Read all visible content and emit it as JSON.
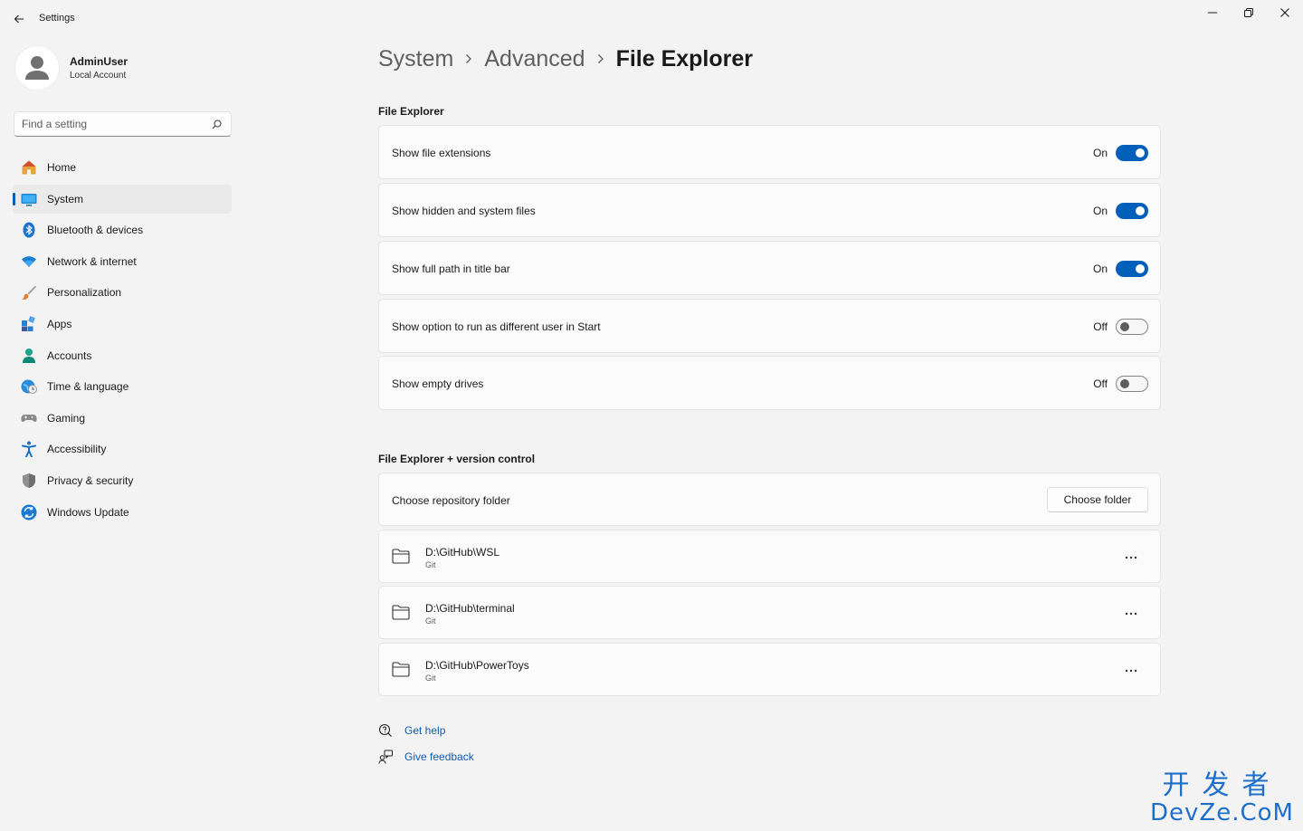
{
  "window": {
    "title": "Settings",
    "controls": [
      "minimize-icon",
      "restore-icon",
      "close-icon"
    ]
  },
  "profile": {
    "name": "AdminUser",
    "account_type": "Local Account"
  },
  "search": {
    "placeholder": "Find a setting",
    "value": ""
  },
  "sidebar": {
    "items": [
      {
        "label": "Home",
        "icon": "home-icon",
        "active": false
      },
      {
        "label": "System",
        "icon": "system-icon",
        "active": true
      },
      {
        "label": "Bluetooth & devices",
        "icon": "bluetooth-icon",
        "active": false
      },
      {
        "label": "Network & internet",
        "icon": "wifi-icon",
        "active": false
      },
      {
        "label": "Personalization",
        "icon": "brush-icon",
        "active": false
      },
      {
        "label": "Apps",
        "icon": "apps-icon",
        "active": false
      },
      {
        "label": "Accounts",
        "icon": "accounts-icon",
        "active": false
      },
      {
        "label": "Time & language",
        "icon": "globe-clock-icon",
        "active": false
      },
      {
        "label": "Gaming",
        "icon": "gamepad-icon",
        "active": false
      },
      {
        "label": "Accessibility",
        "icon": "accessibility-icon",
        "active": false
      },
      {
        "label": "Privacy & security",
        "icon": "shield-icon",
        "active": false
      },
      {
        "label": "Windows Update",
        "icon": "update-icon",
        "active": false
      }
    ]
  },
  "breadcrumb": [
    "System",
    "Advanced",
    "File Explorer"
  ],
  "file_explorer": {
    "title": "File Explorer",
    "settings": [
      {
        "label": "Show file extensions",
        "state": "On",
        "on": true
      },
      {
        "label": "Show hidden and system files",
        "state": "On",
        "on": true
      },
      {
        "label": "Show full path in title bar",
        "state": "On",
        "on": true
      },
      {
        "label": "Show option to run as different user in Start",
        "state": "Off",
        "on": false
      },
      {
        "label": "Show empty drives",
        "state": "Off",
        "on": false
      }
    ]
  },
  "version_control": {
    "title": "File Explorer + version control",
    "choose_label": "Choose repository folder",
    "choose_button": "Choose folder",
    "repos": [
      {
        "path": "D:\\GitHub\\WSL",
        "type": "Git"
      },
      {
        "path": "D:\\GitHub\\terminal",
        "type": "Git"
      },
      {
        "path": "D:\\GitHub\\PowerToys",
        "type": "Git"
      }
    ]
  },
  "links": {
    "help": "Get help",
    "feedback": "Give feedback"
  },
  "watermark": {
    "cn": "开发者",
    "en": "DevZe.CoM"
  },
  "colors": {
    "accent": "#005fb8",
    "background": "#f3f3f3",
    "card": "#fbfbfb",
    "link": "#0f5cad"
  }
}
